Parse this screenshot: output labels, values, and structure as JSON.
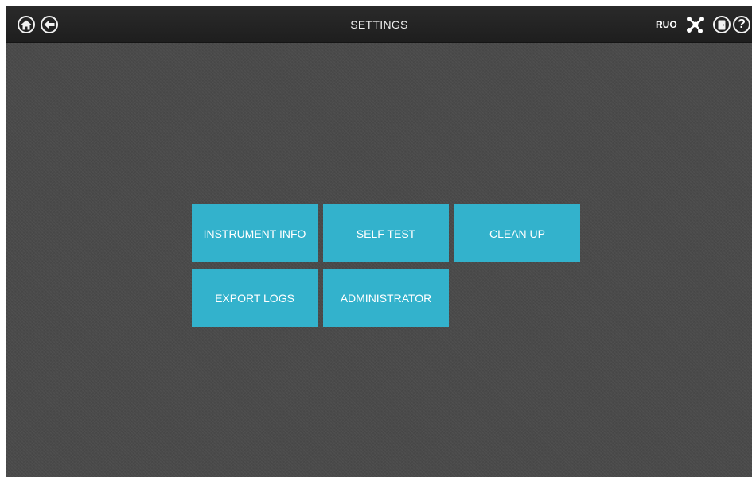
{
  "header": {
    "title": "SETTINGS",
    "ruo_label": "RUO",
    "help_glyph": "?",
    "icons": [
      "home-icon",
      "back-arrow-icon",
      "network-icon",
      "exit-door-icon",
      "help-icon"
    ]
  },
  "menu": {
    "instrument_info": "INSTRUMENT INFO",
    "self_test": "SELF TEST",
    "clean_up": "CLEAN UP",
    "export_logs": "EXPORT LOGS",
    "administrator": "ADMINISTRATOR"
  },
  "colors": {
    "tile": "#33b2cc",
    "topbar": "#222222",
    "background": "#4a4a4a"
  }
}
